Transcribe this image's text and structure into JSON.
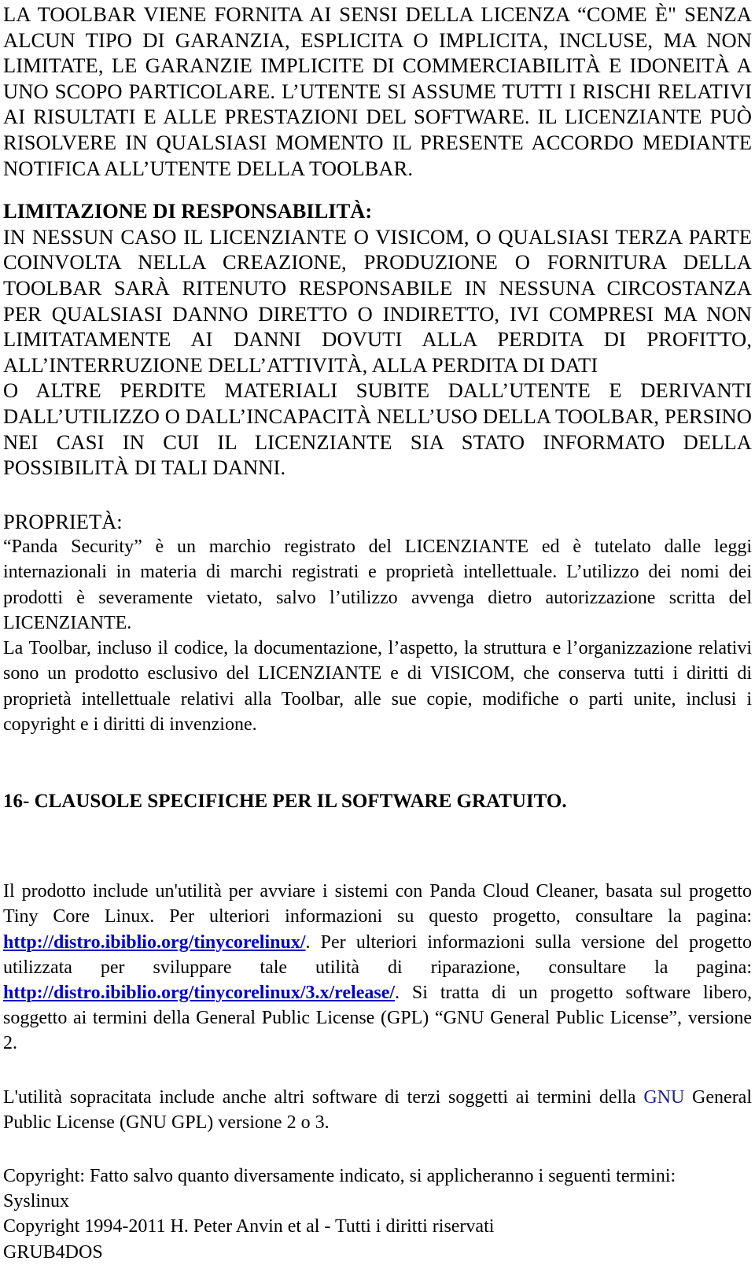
{
  "document": {
    "language": "it",
    "link_color": "#0000CC",
    "reference_color": "#1F1F8F",
    "text_color": "#000000",
    "background_color": "#FFFFFF",
    "blocks": {
      "disclaimer_warranty": "LA TOOLBAR VIENE FORNITA AI SENSI DELLA LICENZA “COME È\" SENZA ALCUN TIPO DI GARANZIA, ESPLICITA O IMPLICITA, INCLUSE, MA NON LIMITATE, LE GARANZIE IMPLICITE DI COMMERCIABILITÀ E IDONEITÀ A UNO SCOPO PARTICOLARE. L’UTENTE SI ASSUME TUTTI I RISCHI RELATIVI AI RISULTATI E ALLE PRESTAZIONI DEL SOFTWARE.  IL LICENZIANTE PUÒ RISOLVERE IN QUALSIASI MOMENTO IL PRESENTE ACCORDO MEDIANTE NOTIFICA ALL’UTENTE DELLA TOOLBAR.",
      "liability_heading": "LIMITAZIONE DI RESPONSABILITÀ:",
      "liability_body_1": "IN NESSUN CASO IL LICENZIANTE O VISICOM, O QUALSIASI TERZA PARTE COINVOLTA NELLA CREAZIONE, PRODUZIONE O FORNITURA DELLA TOOLBAR SARÀ RITENUTO RESPONSABILE IN NESSUNA CIRCOSTANZA PER QUALSIASI DANNO DIRETTO O INDIRETTO, IVI COMPRESI MA NON LIMITATAMENTE AI DANNI DOVUTI ALLA PERDITA DI PROFITTO, ALL’INTERRUZIONE DELL’ATTIVITÀ, ALLA PERDITA DI DATI",
      "liability_body_2": "O ALTRE PERDITE MATERIALI SUBITE DALL’UTENTE E DERIVANTI DALL’UTILIZZO O DALL’INCAPACITÀ NELL’USO DELLA TOOLBAR, PERSINO NEI CASI IN CUI IL LICENZIANTE SIA STATO INFORMATO DELLA POSSIBILITÀ DI TALI DANNI.",
      "property_heading": "PROPRIETÀ:",
      "property_body_1": "“Panda Security” è un marchio registrato del LICENZIANTE ed è tutelato dalle leggi internazionali in materia di marchi registrati e proprietà intellettuale. L’utilizzo dei nomi dei prodotti è severamente vietato, salvo l’utilizzo avvenga dietro autorizzazione scritta del LICENZIANTE.",
      "property_body_2": "La Toolbar, incluso il codice, la documentazione, l’aspetto, la struttura e l’organizzazione relativi sono un prodotto esclusivo del LICENZIANTE e di VISICOM, che conserva tutti i diritti di proprietà intellettuale relativi alla Toolbar, alle sue copie, modifiche o parti unite, inclusi i copyright e i diritti di invenzione.",
      "section16_heading": "16- CLAUSOLE SPECIFICHE PER IL SOFTWARE GRATUITO.",
      "free_software_part1": "Il prodotto include un'utilità per avviare i sistemi con Panda Cloud Cleaner, basata sul progetto Tiny Core Linux. Per ulteriori informazioni su questo progetto, consultare la pagina: ",
      "link_tinycore": "http://distro.ibiblio.org/tinycorelinux/",
      "free_software_part2": ". Per ulteriori informazioni sulla versione del progetto utilizzata per sviluppare tale utilità di riparazione, consultare la pagina: ",
      "link_tinycore_release": "http://distro.ibiblio.org/tinycorelinux/3.x/release/",
      "free_software_part3": ". Si tratta di un progetto software libero, soggetto ai termini della General Public License (GPL) “GNU General Public License”, versione 2.",
      "third_party_part1": "L'utilità sopracitata include anche altri software di terzi soggetti ai termini della ",
      "third_party_gnu": "GNU",
      "third_party_part2": " General Public License (GNU GPL) versione 2 o 3.",
      "copyright_intro": "Copyright: Fatto salvo quanto diversamente indicato, si applicheranno i seguenti termini:",
      "syslinux_name": "Syslinux",
      "syslinux_copyright": "Copyright 1994-2011 H. Peter Anvin et al - Tutti i diritti riservati",
      "grub4dos_name": "GRUB4DOS"
    }
  }
}
